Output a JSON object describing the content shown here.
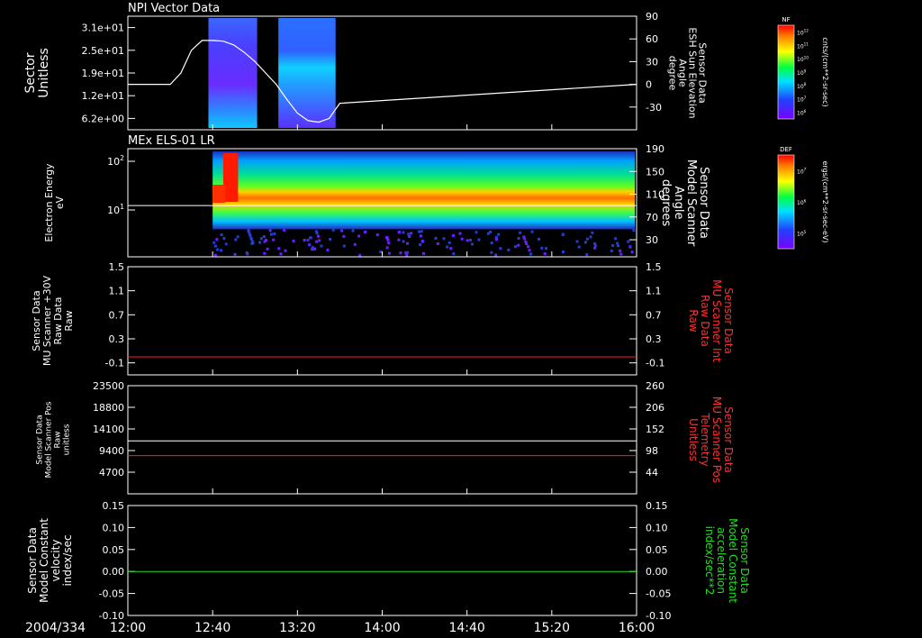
{
  "colors": {
    "background": "#000000",
    "axis": "#ffffff",
    "red_trace": "#ff2020",
    "green_trace": "#20e020",
    "white_trace": "#ffffff"
  },
  "time_axis": {
    "date_label": "2004/334",
    "ticks": [
      "12:00",
      "12:40",
      "13:20",
      "14:00",
      "14:40",
      "15:20",
      "16:00"
    ]
  },
  "colorbars": [
    {
      "title": "NF",
      "label": "cnts/(cm**2-sr-sec)",
      "ticks": [
        "10^12",
        "10^11",
        "10^10",
        "10^9",
        "10^8",
        "10^7",
        "10^6"
      ]
    },
    {
      "title": "DEF",
      "label": "ergs/(cm**2-sr-sec-eV)",
      "ticks": [
        "10^7",
        "10^6",
        "10^5"
      ]
    }
  ],
  "chart_data": [
    {
      "type": "heatmap",
      "title": "NPI Vector Data",
      "ylabel": [
        "Sector",
        "Unitless"
      ],
      "yticks": [
        "3.1e+01",
        "2.5e+01",
        "1.9e+01",
        "1.2e+01",
        "6.2e+00"
      ],
      "right_ylabel": [
        "Sensor Data",
        "ESH Sun Elevation",
        "Angle",
        "degree"
      ],
      "right_yticks": [
        "90",
        "60",
        "30",
        "0",
        "-30"
      ],
      "right_ylim": [
        -60,
        90
      ],
      "data_intervals_minutes": [
        [
          38,
          61
        ],
        [
          71,
          98
        ]
      ],
      "overlay_line": {
        "color": "white",
        "t_minutes": [
          0,
          20,
          25,
          30,
          35,
          40,
          45,
          50,
          55,
          60,
          65,
          70,
          75,
          80,
          85,
          90,
          95,
          100,
          240
        ],
        "values": [
          0,
          0,
          15,
          45,
          58,
          58,
          57,
          52,
          42,
          30,
          15,
          0,
          -20,
          -38,
          -48,
          -50,
          -45,
          -25,
          0
        ]
      }
    },
    {
      "type": "heatmap",
      "title": "MEx ELS-01 LR",
      "ylabel": [
        "Electron Energy",
        "eV"
      ],
      "yticks": [
        "10^2",
        "10^1"
      ],
      "ylog": true,
      "right_ylabel": [
        "Sensor Data",
        "Model Scanner",
        "Angle",
        "degrees"
      ],
      "right_yticks": [
        "190",
        "150",
        "110",
        "70",
        "30"
      ],
      "right_ylim": [
        0,
        190
      ],
      "data_start_minutes": 40,
      "overlay_line": {
        "color": "white",
        "value": 90
      }
    },
    {
      "type": "line",
      "ylabel": [
        "Sensor Data",
        "MU Scanner +30V",
        "Raw Data",
        "Raw"
      ],
      "yticks": [
        "1.5",
        "1.1",
        "0.7",
        "0.3",
        "-0.1"
      ],
      "right_yticks": [
        "1.5",
        "1.1",
        "0.7",
        "0.3",
        "-0.1"
      ],
      "ylim": [
        -0.3,
        1.5
      ],
      "right_ylabel": [
        "Sensor Data",
        "MU Scanner Int",
        "Raw Data",
        "Raw"
      ],
      "series": [
        {
          "color": "red",
          "value": 0.0
        }
      ]
    },
    {
      "type": "line",
      "ylabel": [
        "Sensor Data",
        "Model Scanner Pos",
        "Raw",
        "unitless"
      ],
      "yticks": [
        "23500",
        "18800",
        "14100",
        "9400",
        "4700"
      ],
      "ylim": [
        0,
        23500
      ],
      "right_ylabel": [
        "Sensor Data",
        "MU Scanner Pos",
        "Telemetry",
        "Unitless"
      ],
      "right_yticks": [
        "260",
        "206",
        "152",
        "98",
        "44"
      ],
      "right_ylim": [
        -10,
        260
      ],
      "series": [
        {
          "color": "white",
          "value": 11500
        },
        {
          "color": "red",
          "value": 8300
        }
      ]
    },
    {
      "type": "line",
      "ylabel": [
        "Sensor Data",
        "Model Constant",
        "velocity",
        "index/sec"
      ],
      "yticks": [
        "0.15",
        "0.10",
        "0.05",
        "0.00",
        "-0.05",
        "-0.10"
      ],
      "ylim": [
        -0.1,
        0.15
      ],
      "right_ylabel": [
        "Sensor Data",
        "Model Constant",
        "acceleration",
        "index/sec**2"
      ],
      "right_yticks": [
        "0.15",
        "0.10",
        "0.05",
        "0.00",
        "-0.05",
        "-0.10"
      ],
      "series": [
        {
          "color": "green",
          "value": 0.0
        }
      ]
    }
  ]
}
